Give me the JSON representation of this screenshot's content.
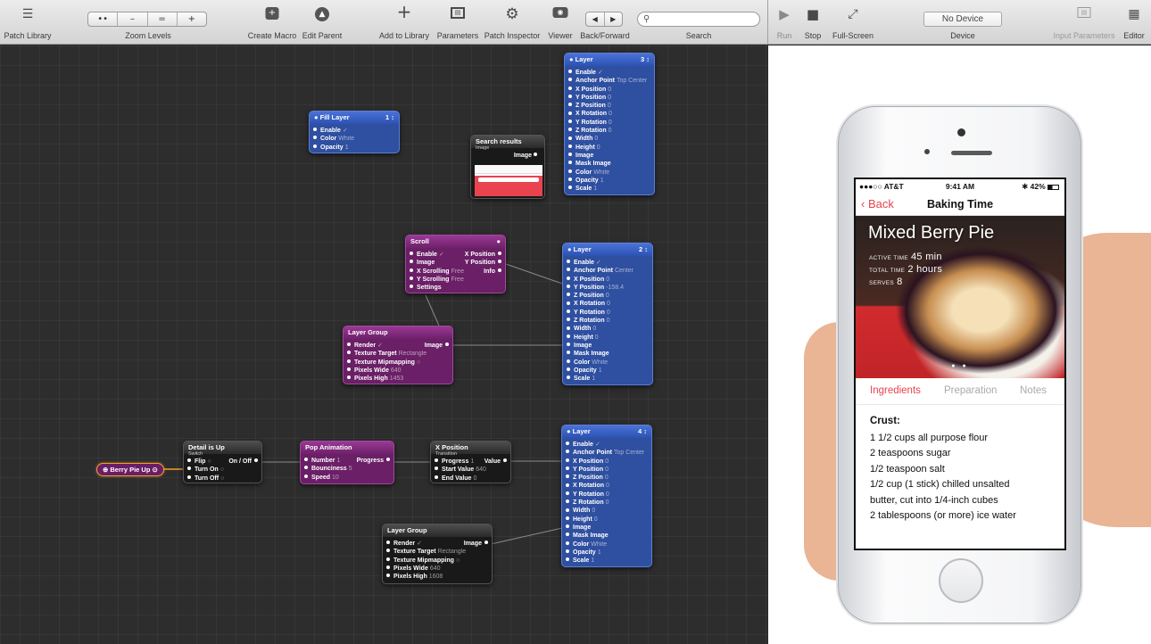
{
  "toolbar_left": {
    "patch_library": {
      "icon": "list-icon",
      "label": "Patch Library"
    },
    "zoom_levels": {
      "segments": [
        "••",
        "–",
        "=",
        "+"
      ],
      "label": "Zoom Levels"
    },
    "create_macro": {
      "icon": "plus-box-icon",
      "label": "Create Macro"
    },
    "edit_parent": {
      "icon": "up-circle-icon",
      "label": "Edit Parent"
    },
    "add_to_library": {
      "icon": "plus-icon",
      "label": "Add to Library"
    },
    "parameters": {
      "icon": "panel-icon",
      "label": "Parameters"
    },
    "patch_inspector": {
      "icon": "gear-icon",
      "label": "Patch Inspector"
    },
    "viewer": {
      "icon": "eye-icon",
      "label": "Viewer"
    },
    "back_forward": {
      "segments": [
        "◀",
        "▶"
      ],
      "label": "Back/Forward"
    },
    "search": {
      "placeholder": "",
      "label": "Search"
    }
  },
  "toolbar_right": {
    "run": {
      "icon": "play-icon",
      "label": "Run"
    },
    "stop": {
      "icon": "stop-icon",
      "label": "Stop"
    },
    "fullscreen": {
      "icon": "expand-icon",
      "label": "Full-Screen"
    },
    "device": {
      "value": "No Device",
      "label": "Device"
    },
    "input_parameters": {
      "icon": "panel-icon",
      "label": "Input Parameters"
    },
    "editor": {
      "icon": "grid-icon",
      "label": "Editor"
    }
  },
  "nodes": {
    "fill_layer": {
      "title": "Fill Layer",
      "num": "1 ↕",
      "rows": [
        {
          "name": "Enable",
          "value": "✓"
        },
        {
          "name": "Color",
          "value": "White"
        },
        {
          "name": "Opacity",
          "value": "1"
        }
      ]
    },
    "search_results": {
      "title": "Search results",
      "subtitle": "Image",
      "output": "Image"
    },
    "layer3": {
      "title": "Layer",
      "num": "3 ↕",
      "rows": [
        {
          "name": "Enable",
          "value": "✓"
        },
        {
          "name": "Anchor Point",
          "value": "Top Center"
        },
        {
          "name": "X Position",
          "value": "0"
        },
        {
          "name": "Y Position",
          "value": "0"
        },
        {
          "name": "Z Position",
          "value": "0"
        },
        {
          "name": "X Rotation",
          "value": "0"
        },
        {
          "name": "Y Rotation",
          "value": "0"
        },
        {
          "name": "Z Rotation",
          "value": "0"
        },
        {
          "name": "Width",
          "value": "0"
        },
        {
          "name": "Height",
          "value": "0"
        },
        {
          "name": "Image",
          "value": ""
        },
        {
          "name": "Mask Image",
          "value": ""
        },
        {
          "name": "Color",
          "value": "White"
        },
        {
          "name": "Opacity",
          "value": "1"
        },
        {
          "name": "Scale",
          "value": "1"
        }
      ]
    },
    "scroll": {
      "title": "Scroll",
      "rows": [
        {
          "name": "Enable",
          "value": "✓",
          "out": "X Position"
        },
        {
          "name": "Image",
          "value": "",
          "out": "Y Position"
        },
        {
          "name": "X Scrolling",
          "value": "Free",
          "out": "Info"
        },
        {
          "name": "Y Scrolling",
          "value": "Free",
          "out": ""
        },
        {
          "name": "Settings",
          "value": "",
          "out": ""
        }
      ]
    },
    "layer2": {
      "title": "Layer",
      "num": "2 ↕",
      "rows": [
        {
          "name": "Enable",
          "value": "✓"
        },
        {
          "name": "Anchor Point",
          "value": "Center"
        },
        {
          "name": "X Position",
          "value": "0"
        },
        {
          "name": "Y Position",
          "value": "-158.4"
        },
        {
          "name": "Z Position",
          "value": "0"
        },
        {
          "name": "X Rotation",
          "value": "0"
        },
        {
          "name": "Y Rotation",
          "value": "0"
        },
        {
          "name": "Z Rotation",
          "value": "0"
        },
        {
          "name": "Width",
          "value": "0"
        },
        {
          "name": "Height",
          "value": "0"
        },
        {
          "name": "Image",
          "value": ""
        },
        {
          "name": "Mask Image",
          "value": ""
        },
        {
          "name": "Color",
          "value": "White"
        },
        {
          "name": "Opacity",
          "value": "1"
        },
        {
          "name": "Scale",
          "value": "1"
        }
      ]
    },
    "layer_group1": {
      "title": "Layer Group",
      "output": "Image",
      "rows": [
        {
          "name": "Render",
          "value": "✓"
        },
        {
          "name": "Texture Target",
          "value": "Rectangle"
        },
        {
          "name": "Texture Mipmapping",
          "value": "○"
        },
        {
          "name": "Pixels Wide",
          "value": "640"
        },
        {
          "name": "Pixels High",
          "value": "1453"
        }
      ]
    },
    "berry_pie_up": {
      "label": "Berry Pie Up"
    },
    "detail_is_up": {
      "title": "Detail is Up",
      "subtitle": "Switch",
      "out": "On / Off",
      "rows": [
        {
          "name": "Flip",
          "value": "○"
        },
        {
          "name": "Turn On",
          "value": "○"
        },
        {
          "name": "Turn Off",
          "value": "○"
        }
      ]
    },
    "pop_animation": {
      "title": "Pop Animation",
      "out": "Progress",
      "rows": [
        {
          "name": "Number",
          "value": "1"
        },
        {
          "name": "Bounciness",
          "value": "5"
        },
        {
          "name": "Speed",
          "value": "10"
        }
      ]
    },
    "x_position": {
      "title": "X Position",
      "subtitle": "Transition",
      "out": "Value",
      "rows": [
        {
          "name": "Progress",
          "value": "1"
        },
        {
          "name": "Start Value",
          "value": "640"
        },
        {
          "name": "End Value",
          "value": "0"
        }
      ]
    },
    "layer4": {
      "title": "Layer",
      "num": "4 ↕",
      "rows": [
        {
          "name": "Enable",
          "value": "✓"
        },
        {
          "name": "Anchor Point",
          "value": "Top Center"
        },
        {
          "name": "X Position",
          "value": "0"
        },
        {
          "name": "Y Position",
          "value": "0"
        },
        {
          "name": "Z Position",
          "value": "0"
        },
        {
          "name": "X Rotation",
          "value": "0"
        },
        {
          "name": "Y Rotation",
          "value": "0"
        },
        {
          "name": "Z Rotation",
          "value": "0"
        },
        {
          "name": "Width",
          "value": "0"
        },
        {
          "name": "Height",
          "value": "0"
        },
        {
          "name": "Image",
          "value": ""
        },
        {
          "name": "Mask Image",
          "value": ""
        },
        {
          "name": "Color",
          "value": "White"
        },
        {
          "name": "Opacity",
          "value": "1"
        },
        {
          "name": "Scale",
          "value": "1"
        }
      ]
    },
    "layer_group2": {
      "title": "Layer Group",
      "output": "Image",
      "rows": [
        {
          "name": "Render",
          "value": "✓"
        },
        {
          "name": "Texture Target",
          "value": "Rectangle"
        },
        {
          "name": "Texture Mipmapping",
          "value": "○"
        },
        {
          "name": "Pixels Wide",
          "value": "640"
        },
        {
          "name": "Pixels High",
          "value": "1608"
        }
      ]
    }
  },
  "phone": {
    "status": {
      "carrier": "●●●○○ AT&T",
      "time": "9:41 AM",
      "battery": "42%"
    },
    "nav": {
      "back": "‹ Back",
      "title": "Baking Time"
    },
    "hero": {
      "title": "Mixed Berry Pie",
      "active_label": "Active time",
      "active_value": "45 min",
      "total_label": "Total time",
      "total_value": "2 hours",
      "serves_label": "Serves",
      "serves_value": "8",
      "page_dots": "● ●"
    },
    "tabs": [
      "Ingredients",
      "Preparation",
      "Notes"
    ],
    "recipe": {
      "heading": "Crust:",
      "lines": [
        "1 1/2 cups all purpose flour",
        "2 teaspoons sugar",
        "1/2 teaspoon salt",
        "1/2 cup (1 stick) chilled unsalted",
        "butter, cut into 1/4-inch cubes",
        "2 tablespoons (or more) ice water"
      ]
    }
  },
  "colors": {
    "accent": "#e8434f",
    "layer_blue": "#2f4fa0",
    "patch_purple": "#6a1f66",
    "patch_black": "#191919"
  }
}
